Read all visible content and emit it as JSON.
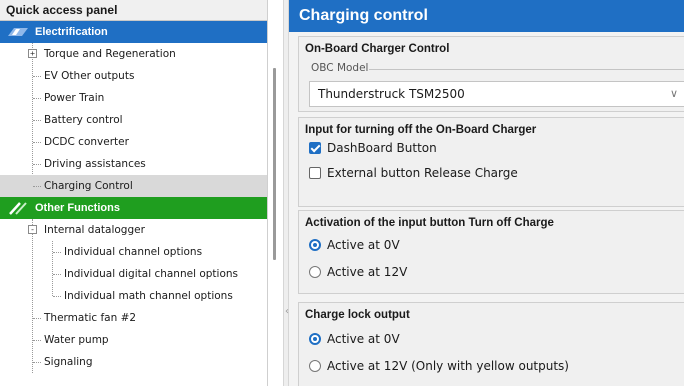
{
  "left_panel": {
    "title": "Quick access panel",
    "categories": [
      {
        "label": "Electrification",
        "color": "#1f6fc4",
        "items": [
          {
            "label": "Torque and Regeneration",
            "expander": "+"
          },
          {
            "label": "EV Other outputs"
          },
          {
            "label": "Power Train"
          },
          {
            "label": "Battery control"
          },
          {
            "label": "DCDC converter"
          },
          {
            "label": "Driving assistances"
          },
          {
            "label": "Charging Control",
            "selected": true
          }
        ]
      },
      {
        "label": "Other Functions",
        "color": "#1f9e1f",
        "items": [
          {
            "label": "Internal datalogger",
            "expander": "-"
          },
          {
            "label": "Individual channel options"
          },
          {
            "label": "Individual digital channel options"
          },
          {
            "label": "Individual math channel options"
          },
          {
            "label": "Thermatic fan #2"
          },
          {
            "label": "Water pump"
          },
          {
            "label": "Signaling"
          }
        ]
      }
    ]
  },
  "right_panel": {
    "title": "Charging control",
    "title_color": "#1f6fc4",
    "obc": {
      "title": "On-Board Charger Control",
      "model_label": "OBC Model",
      "model_value": "Thunderstruck TSM2500"
    },
    "turn_off_input": {
      "title": "Input for turning off the On-Board Charger",
      "options": [
        {
          "label": "DashBoard Button",
          "checked": true
        },
        {
          "label": "External button Release Charge",
          "checked": false
        }
      ]
    },
    "activation": {
      "title": "Activation of the input button Turn off Charge",
      "options": [
        {
          "label": "Active at 0V",
          "selected": true
        },
        {
          "label": "Active at 12V",
          "selected": false
        }
      ]
    },
    "charge_lock": {
      "title": "Charge lock output",
      "options": [
        {
          "label": "Active at 0V",
          "selected": true
        },
        {
          "label": "Active at 12V (Only with yellow outputs)",
          "selected": false
        }
      ]
    }
  }
}
